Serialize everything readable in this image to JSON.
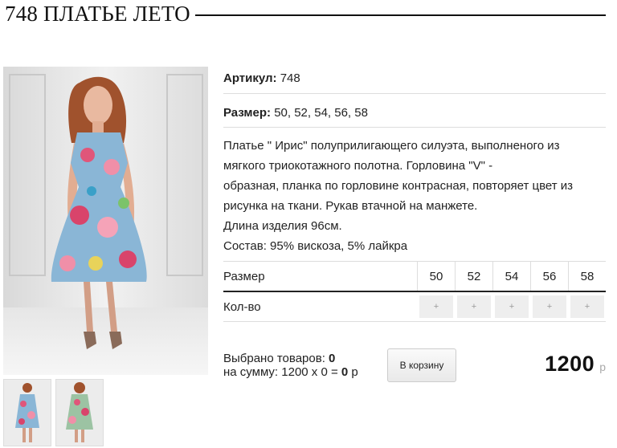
{
  "product": {
    "title": "748 ПЛАТЬЕ ЛЕТО",
    "sku_label": "Артикул:",
    "sku_value": "748",
    "size_label": "Размер:",
    "size_value": "50, 52, 54, 56, 58",
    "description": [
      "Платье \" Ирис\" полуприлигающего силуэта, выполненого из",
      "мягкого триокотажного полотна. Горловина \"V\" -",
      "образная,  планка по горловине контрасная, повторяет цвет из",
      "рисунка на ткани. Рукав втачной на манжете.",
      "Длина изделия 96см.",
      "Состав: 95% вискоза, 5% лайкра"
    ]
  },
  "qty_table": {
    "size_header": "Размер",
    "qty_header": "Кол-во",
    "sizes": [
      "50",
      "52",
      "54",
      "56",
      "58"
    ],
    "plus_symbol": "+"
  },
  "order": {
    "selected_label": "Выбрано товаров:",
    "selected_count": "0",
    "sum_label": "на сумму: 1200 х 0 =",
    "sum_value": "0",
    "sum_currency": "р",
    "cart_button": "В корзину",
    "price": "1200",
    "price_currency": "р"
  },
  "images": {
    "main": "model-photo",
    "thumbs": [
      "thumb-front",
      "thumb-back"
    ]
  }
}
